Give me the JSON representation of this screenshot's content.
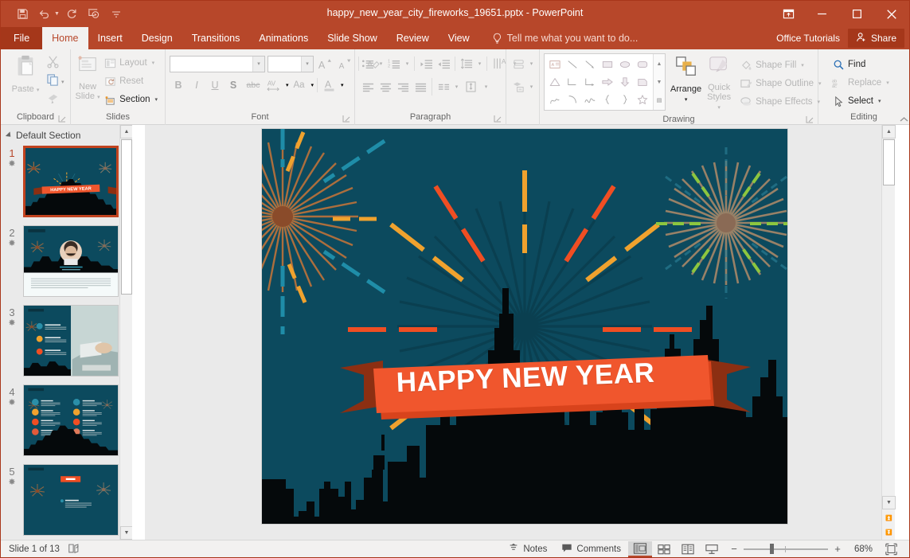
{
  "window": {
    "title": "happy_new_year_city_fireworks_19651.pptx - PowerPoint",
    "quick_access": [
      {
        "name": "save-icon",
        "label": "Save"
      },
      {
        "name": "undo-icon",
        "label": "Undo"
      },
      {
        "name": "redo-icon",
        "label": "Repeat"
      },
      {
        "name": "start-presentation-icon",
        "label": "Start From Beginning"
      },
      {
        "name": "customize-qat-icon",
        "label": "Customize Quick Access Toolbar"
      }
    ],
    "controls": {
      "ribbon_display": "Ribbon Display Options",
      "minimize": "Minimize",
      "restore": "Restore Down",
      "close": "Close"
    }
  },
  "tabs": [
    {
      "label": "File",
      "active": false,
      "file": true
    },
    {
      "label": "Home",
      "active": true
    },
    {
      "label": "Insert",
      "active": false
    },
    {
      "label": "Design",
      "active": false
    },
    {
      "label": "Transitions",
      "active": false
    },
    {
      "label": "Animations",
      "active": false
    },
    {
      "label": "Slide Show",
      "active": false
    },
    {
      "label": "Review",
      "active": false
    },
    {
      "label": "View",
      "active": false
    }
  ],
  "tell_me": {
    "placeholder": "Tell me what you want to do..."
  },
  "account": {
    "office_tutorials": "Office Tutorials",
    "share": "Share"
  },
  "ribbon": {
    "clipboard": {
      "label": "Clipboard",
      "paste": "Paste",
      "cut": "Cut",
      "copy": "Copy",
      "format_painter": "Format Painter"
    },
    "slides": {
      "label": "Slides",
      "new_slide": "New\nSlide",
      "new_slide_line1": "New",
      "new_slide_line2": "Slide",
      "layout": "Layout",
      "reset": "Reset",
      "section": "Section"
    },
    "font": {
      "label": "Font",
      "font_name": "",
      "font_name_placeholder": "",
      "font_size": "",
      "increase_size": "A",
      "decrease_size": "A",
      "clear_formatting": "Clear All Formatting",
      "bold": "B",
      "italic": "I",
      "underline": "U",
      "shadow": "S",
      "strikethrough": "abc",
      "character_spacing": "AV",
      "change_case": "Aa",
      "font_color": "A"
    },
    "paragraph": {
      "label": "Paragraph",
      "bullets": "Bullets",
      "numbering": "Numbering",
      "decrease_indent": "Decrease List Level",
      "increase_indent": "Increase List Level",
      "line_spacing": "Line Spacing",
      "text_direction": "Text Direction",
      "align_text": "Align Text",
      "convert_smartart": "Convert to SmartArt",
      "align_left": "Align Left",
      "align_center": "Center",
      "align_right": "Align Right",
      "justify": "Justify",
      "columns": "Columns"
    },
    "drawing": {
      "label": "Drawing",
      "arrange": "Arrange",
      "quick_styles_line1": "Quick",
      "quick_styles_line2": "Styles",
      "shape_fill": "Shape Fill",
      "shape_outline": "Shape Outline",
      "shape_effects": "Shape Effects",
      "shapes": [
        "text-box",
        "line",
        "line-arrow",
        "rectangle",
        "oval",
        "rounded-rectangle",
        "triangle",
        "elbow-connector",
        "elbow-arrow-connector",
        "arrow-right",
        "arrow-down",
        "flowchart-shape",
        "freeform-scribble",
        "arc",
        "curve",
        "left-brace",
        "right-brace",
        "star-5-point"
      ]
    },
    "editing": {
      "label": "Editing",
      "find": "Find",
      "replace": "Replace",
      "select": "Select"
    }
  },
  "thumbnails": {
    "section_name": "Default Section",
    "slides": [
      {
        "number": "1",
        "selected": true,
        "variant": "title"
      },
      {
        "number": "2",
        "selected": false,
        "variant": "profile"
      },
      {
        "number": "3",
        "selected": false,
        "variant": "bullets-photo"
      },
      {
        "number": "4",
        "selected": false,
        "variant": "icon-grid"
      },
      {
        "number": "5",
        "selected": false,
        "variant": "badge-text"
      }
    ]
  },
  "slide": {
    "banner_text": "HAPPY NEW YEAR",
    "background_color": "#0c4a5e",
    "banner_color": "#f0562d",
    "banner_fold_color": "#8c2f12",
    "skyline_color": "#05090b",
    "fireworks": [
      {
        "name": "firework-left",
        "core_color": "#8a4b2a",
        "dash_colors": [
          "#f0a22e",
          "#1f8da8"
        ]
      },
      {
        "name": "firework-center",
        "core_color": "#0a3f50",
        "dash_colors": [
          "#f0a22e",
          "#f04e23"
        ]
      },
      {
        "name": "firework-right",
        "core_color": "#8a6a55",
        "dash_colors": [
          "#8cc63f",
          "#2a7f96"
        ]
      }
    ]
  },
  "status": {
    "slide_indicator": "Slide 1 of 13",
    "accessibility": "Accessibility Checker",
    "notes": "Notes",
    "comments": "Comments",
    "views": [
      {
        "name": "normal-view",
        "label": "Normal",
        "active": true
      },
      {
        "name": "slide-sorter-view",
        "label": "Slide Sorter",
        "active": false
      },
      {
        "name": "reading-view",
        "label": "Reading View",
        "active": false
      },
      {
        "name": "slide-show-view",
        "label": "Slide Show",
        "active": false
      }
    ],
    "zoom_out": "−",
    "zoom_in": "+",
    "zoom_level": "68%",
    "fit_to_window": "Fit slide to current window"
  }
}
